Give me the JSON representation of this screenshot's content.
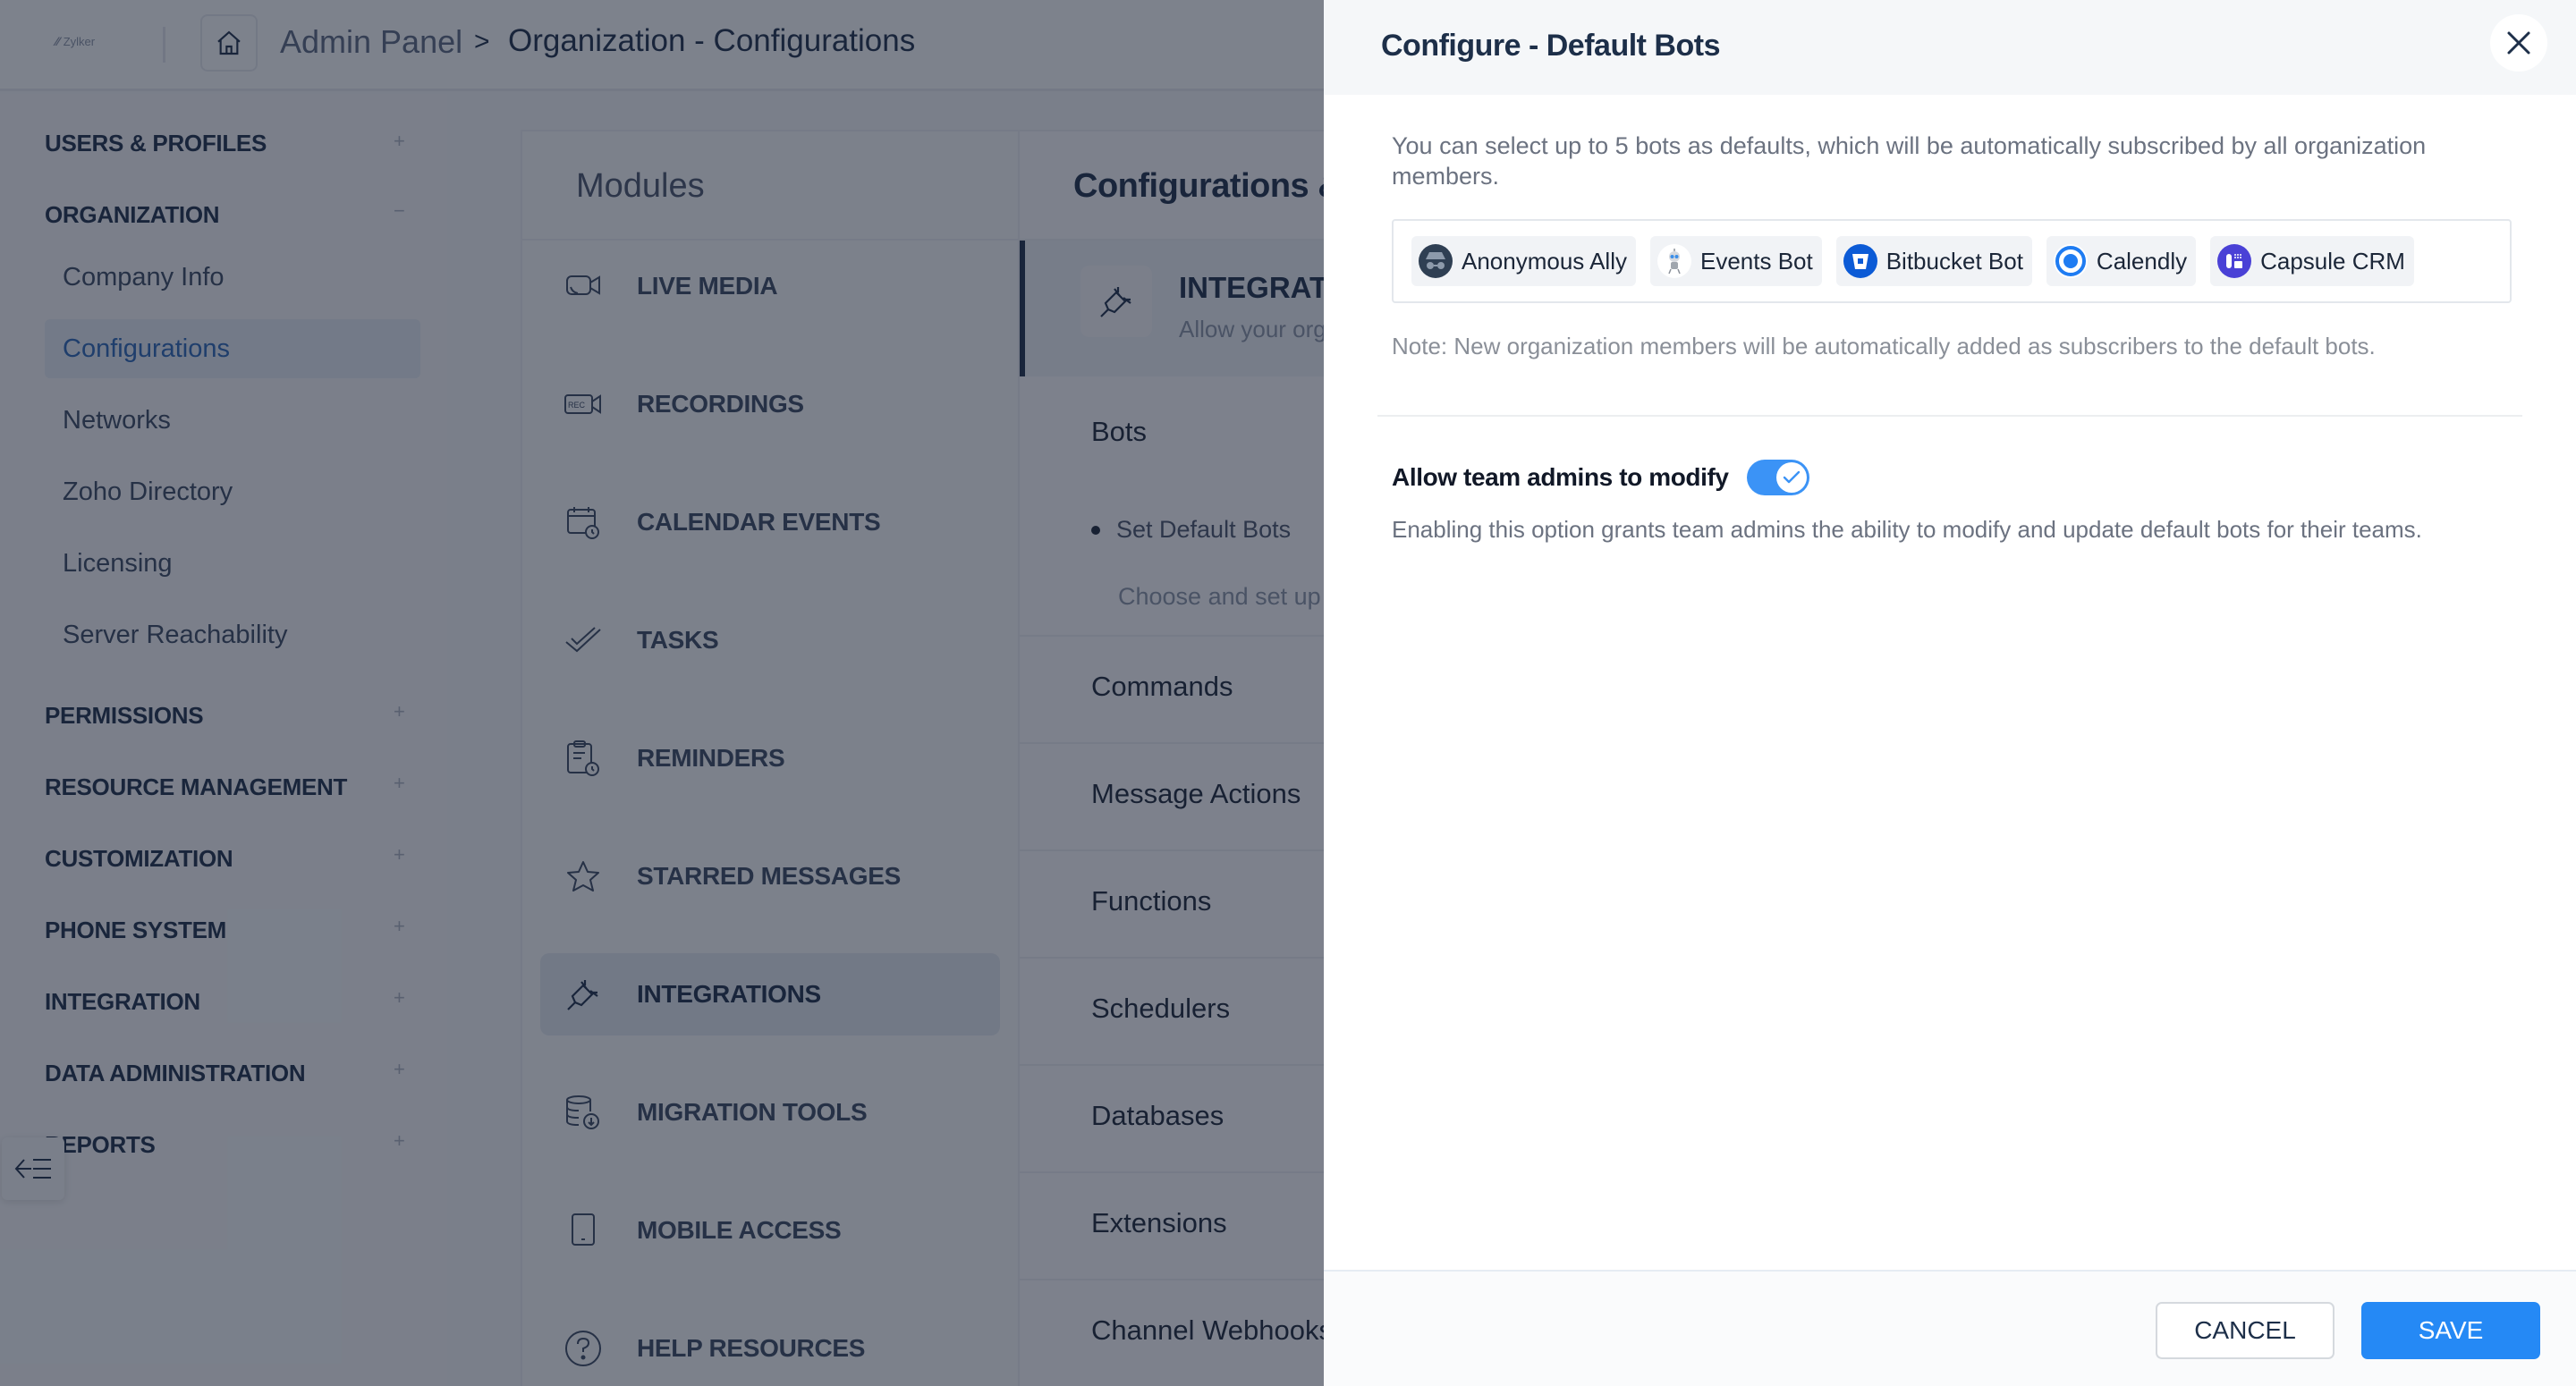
{
  "header": {
    "brand": "Zylker",
    "breadcrumb": [
      "Admin Panel",
      "Organization - Configurations"
    ],
    "breadcrumb_separator": ">",
    "home_icon": "home-icon"
  },
  "sidebar": {
    "sections": [
      {
        "label": "USERS & PROFILES",
        "toggle": "+"
      },
      {
        "label": "ORGANIZATION",
        "toggle": "−",
        "expanded": true,
        "items": [
          {
            "label": "Company Info"
          },
          {
            "label": "Configurations",
            "active": true
          },
          {
            "label": "Networks"
          },
          {
            "label": "Zoho Directory"
          },
          {
            "label": "Licensing"
          },
          {
            "label": "Server Reachability"
          }
        ]
      },
      {
        "label": "PERMISSIONS",
        "toggle": "+"
      },
      {
        "label": "RESOURCE MANAGEMENT",
        "toggle": "+"
      },
      {
        "label": "CUSTOMIZATION",
        "toggle": "+"
      },
      {
        "label": "PHONE SYSTEM",
        "toggle": "+"
      },
      {
        "label": "INTEGRATION",
        "toggle": "+"
      },
      {
        "label": "DATA ADMINISTRATION",
        "toggle": "+"
      },
      {
        "label": "REPORTS",
        "toggle": "+"
      }
    ],
    "collapse_icon": "collapse-sidebar-icon"
  },
  "modules": {
    "title": "Modules",
    "items": [
      {
        "label": "LIVE MEDIA",
        "icon": "video-call-icon"
      },
      {
        "label": "RECORDINGS",
        "icon": "recording-icon"
      },
      {
        "label": "CALENDAR EVENTS",
        "icon": "calendar-clock-icon"
      },
      {
        "label": "TASKS",
        "icon": "double-check-icon"
      },
      {
        "label": "REMINDERS",
        "icon": "reminder-icon"
      },
      {
        "label": "STARRED MESSAGES",
        "icon": "star-icon"
      },
      {
        "label": "INTEGRATIONS",
        "icon": "plug-icon",
        "active": true
      },
      {
        "label": "MIGRATION TOOLS",
        "icon": "database-download-icon"
      },
      {
        "label": "MOBILE ACCESS",
        "icon": "mobile-icon"
      },
      {
        "label": "HELP RESOURCES",
        "icon": "help-icon"
      }
    ]
  },
  "config": {
    "title": "Configurations & S",
    "integrations": {
      "title": "INTEGRATIONS",
      "description": "Allow your org"
    },
    "bots": {
      "heading": "Bots",
      "bullet": "Set Default Bots",
      "bullet_desc": "Choose and set up d"
    },
    "rows": [
      "Commands",
      "Message Actions",
      "Functions",
      "Schedulers",
      "Databases",
      "Extensions",
      "Channel Webhooks"
    ]
  },
  "drawer": {
    "title": "Configure - Default Bots",
    "description": "You can select up to 5 bots as defaults, which will be automatically subscribed by all organization members.",
    "selected_bots": [
      {
        "name": "Anonymous Ally",
        "icon": "incognito-avatar-icon",
        "color": "#2f3f53"
      },
      {
        "name": "Events Bot",
        "icon": "robot-avatar-icon",
        "color": "#ffffff"
      },
      {
        "name": "Bitbucket Bot",
        "icon": "bitbucket-icon",
        "color": "#0c5bd6"
      },
      {
        "name": "Calendly",
        "icon": "calendly-icon",
        "color": "#1f7cf2"
      },
      {
        "name": "Capsule CRM",
        "icon": "capsule-crm-icon",
        "color": "#4a41d6"
      }
    ],
    "note": "Note: New organization members will be automatically added as subscribers to the default bots.",
    "allow_modify": {
      "label": "Allow team admins to modify",
      "enabled": true,
      "description": "Enabling this option grants team admins the ability to modify and update default bots for their teams."
    },
    "buttons": {
      "cancel": "CANCEL",
      "save": "SAVE"
    },
    "accent_color": "#2589f5"
  }
}
